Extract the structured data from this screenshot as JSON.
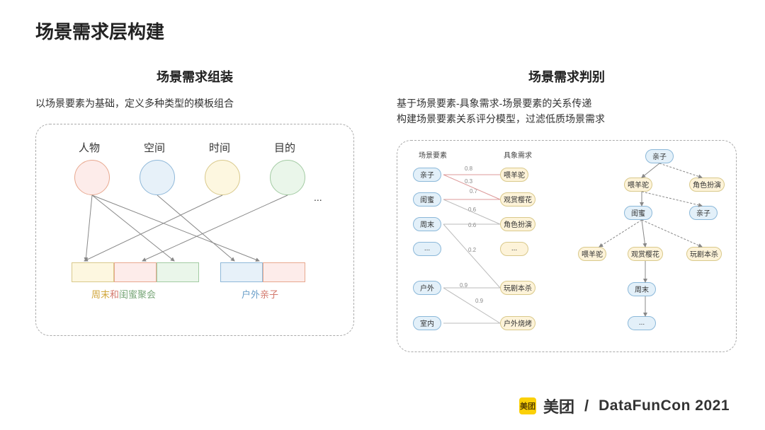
{
  "title": "场景需求层构建",
  "left": {
    "subtitle": "场景需求组装",
    "desc": "以场景要素为基础，定义多种类型的模板组合",
    "elements": [
      "人物",
      "空间",
      "时间",
      "目的"
    ],
    "ellipsis": "...",
    "combos": [
      {
        "caption": {
          "t1": "周末",
          "t2": "和",
          "t3": "闺蜜聚会"
        }
      },
      {
        "caption": {
          "t1": "户外",
          "t2": "亲子"
        }
      }
    ]
  },
  "right": {
    "subtitle": "场景需求判别",
    "desc_l1": "基于场景要素-具象需求-场景要素的关系传递",
    "desc_l2": "构建场景要素关系评分模型，过滤低质场景需求",
    "col_left": "场景要素",
    "col_right": "具象需求",
    "left_nodes": [
      "亲子",
      "闺蜜",
      "周末",
      "...",
      "户外",
      "室内"
    ],
    "right_nodes": [
      "喂羊驼",
      "观赏樱花",
      "角色扮演",
      "...",
      "玩剧本杀",
      "户外烧烤"
    ],
    "weights": [
      "0.8",
      "0.3",
      "0.7",
      "0.6",
      "0.6",
      "0.2",
      "0.9",
      "0.9"
    ],
    "tree_nodes": {
      "root": "亲子",
      "l2a": "喂羊驼",
      "l2b": "角色扮演",
      "l3a": "闺蜜",
      "l3b": "亲子",
      "l4a": "喂羊驼",
      "l4b": "观赏樱花",
      "l4c": "玩剧本杀",
      "l5a": "周末",
      "l6a": "..."
    }
  },
  "footer": {
    "logo_text": "美团",
    "brand": "美团",
    "event": "DataFunCon 2021"
  }
}
